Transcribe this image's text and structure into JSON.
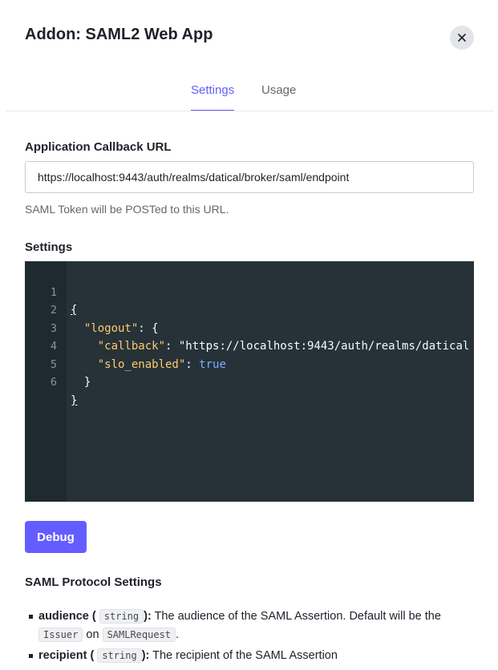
{
  "modal": {
    "title": "Addon: SAML2 Web App",
    "close_icon": "close-icon"
  },
  "tabs": [
    {
      "label": "Settings",
      "active": true
    },
    {
      "label": "Usage",
      "active": false
    }
  ],
  "callback": {
    "label": "Application Callback URL",
    "value": "https://localhost:9443/auth/realms/datical/broker/saml/endpoint",
    "help": "SAML Token will be POSTed to this URL."
  },
  "settings": {
    "label": "Settings",
    "line_numbers": [
      "1",
      "2",
      "3",
      "4",
      "5",
      "6"
    ],
    "code": {
      "l1_open": "{",
      "l2_key": "\"logout\"",
      "l2_rest": ": {",
      "l3_key": "\"callback\"",
      "l3_colon": ": ",
      "l3_val": "\"https://localhost:9443/auth/realms/datical",
      "l4_key": "\"slo_enabled\"",
      "l4_colon": ": ",
      "l4_val": "true",
      "l5_close": "}",
      "l6_close": "}"
    }
  },
  "debug_button": "Debug",
  "protocol": {
    "label": "SAML Protocol Settings",
    "items": [
      {
        "name": "audience (",
        "type": "string",
        "close": "):",
        "text1": "The audience of the SAML Assertion. Default will be the",
        "chip2": "Issuer",
        "mid": "on",
        "chip3": "SAMLRequest",
        "end": "."
      },
      {
        "name": "recipient (",
        "type": "string",
        "close": "):",
        "text1": "The recipient of the SAML Assertion"
      }
    ]
  },
  "colors": {
    "accent": "#635dff",
    "editor_bg": "#263238",
    "text": "#1e212a"
  }
}
